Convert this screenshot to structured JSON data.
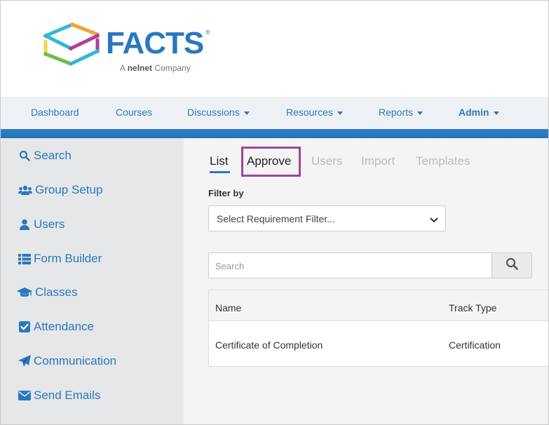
{
  "brand": {
    "name": "FACTS",
    "trademark": "®",
    "tagline_prefix": "A",
    "tagline_brand": "nelnet",
    "tagline_suffix": "Company",
    "colors": {
      "primary": "#2a78bd",
      "nav_stripe": "#2f80c6",
      "highlight_box": "#a1449a",
      "logo_cyan": "#31b8d8",
      "logo_green": "#6ebf4a",
      "logo_orange": "#f2a33a",
      "logo_magenta": "#b33d9a",
      "logo_yellow": "#f6d34a"
    }
  },
  "nav": {
    "items": [
      {
        "label": "Dashboard",
        "has_dropdown": false
      },
      {
        "label": "Courses",
        "has_dropdown": false
      },
      {
        "label": "Discussions",
        "has_dropdown": true
      },
      {
        "label": "Resources",
        "has_dropdown": true
      },
      {
        "label": "Reports",
        "has_dropdown": true
      },
      {
        "label": "Admin",
        "has_dropdown": true
      }
    ]
  },
  "sidebar": {
    "items": [
      {
        "label": "Search",
        "icon": "search-icon"
      },
      {
        "label": "Group Setup",
        "icon": "group-icon"
      },
      {
        "label": "Users",
        "icon": "user-icon"
      },
      {
        "label": "Form Builder",
        "icon": "list-icon"
      },
      {
        "label": "Classes",
        "icon": "graduation-cap-icon"
      },
      {
        "label": "Attendance",
        "icon": "checkbox-icon"
      },
      {
        "label": "Communication",
        "icon": "paper-plane-icon"
      },
      {
        "label": "Send Emails",
        "icon": "envelope-icon"
      }
    ]
  },
  "main": {
    "tabs": [
      {
        "label": "List",
        "active": true
      },
      {
        "label": "Approve",
        "active": false,
        "highlighted": true
      },
      {
        "label": "Users",
        "active": false
      },
      {
        "label": "Import",
        "active": false
      },
      {
        "label": "Templates",
        "active": false
      }
    ],
    "filter": {
      "label": "Filter by",
      "selected": "Select Requirement Filter..."
    },
    "search": {
      "placeholder": "Search"
    },
    "table": {
      "columns": [
        "Name",
        "Track Type"
      ],
      "rows": [
        [
          "Certificate of Completion",
          "Certification"
        ]
      ]
    }
  }
}
